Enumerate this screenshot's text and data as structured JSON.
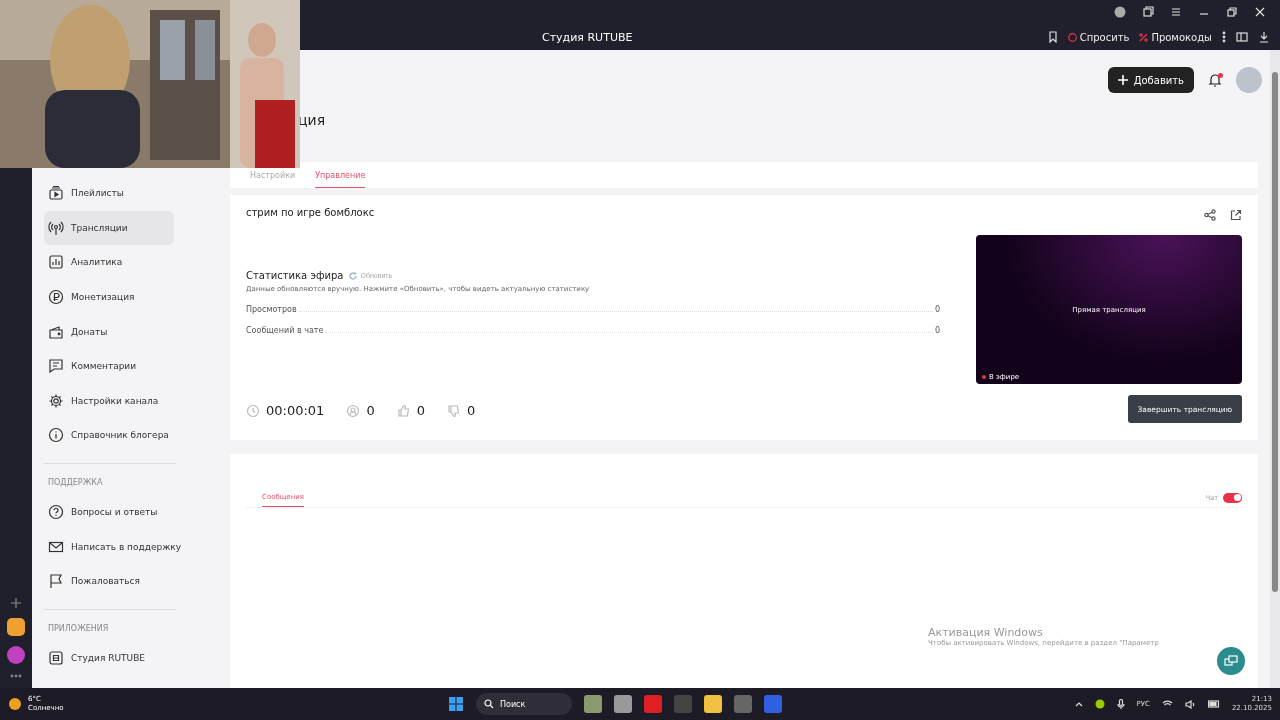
{
  "browser": {
    "tab_title": "Студия RUTUBE",
    "actions": [
      {
        "kind": "ask",
        "label": "Спросить"
      },
      {
        "kind": "promo",
        "label": "Промокоды"
      }
    ]
  },
  "header": {
    "add_button": "Добавить",
    "notification": true
  },
  "page_title": "ция",
  "sidebar": {
    "sections": [
      {
        "items": [
          {
            "label": "Плейлисты",
            "selected": false
          },
          {
            "label": "Трансляции",
            "selected": true
          },
          {
            "label": "Аналитика",
            "selected": false
          },
          {
            "label": "Монетизация",
            "selected": false
          },
          {
            "label": "Донаты",
            "selected": false
          },
          {
            "label": "Комментарии",
            "selected": false
          },
          {
            "label": "Настройки канала",
            "selected": false
          },
          {
            "label": "Справочник блогера",
            "selected": false
          }
        ]
      },
      {
        "heading": "ПОДДЕРЖКА",
        "items": [
          {
            "label": "Вопросы и ответы",
            "selected": false
          },
          {
            "label": "Написать в поддержку",
            "selected": false
          },
          {
            "label": "Пожаловаться",
            "selected": false
          }
        ]
      },
      {
        "heading": "ПРИЛОЖЕНИЯ",
        "items": [
          {
            "label": "Студия RUTUBE",
            "selected": false
          }
        ]
      }
    ]
  },
  "tabs": [
    {
      "label": "Настройки",
      "selected": false
    },
    {
      "label": "Управление",
      "selected": true
    }
  ],
  "stream": {
    "title": "стрим по игре бомблокс",
    "stats_title": "Статистика эфира",
    "refresh": "Обновить",
    "stats_note": "Данные обновляются вручную. Нажмите «Обновить», чтобы видеть актуальную статистику",
    "stats": [
      {
        "label": "Просмотров",
        "value": "0"
      },
      {
        "label": "Сообщений в чате",
        "value": "0"
      }
    ],
    "counters": [
      {
        "kind": "time",
        "value": "00:00:01"
      },
      {
        "kind": "viewers",
        "value": "0"
      },
      {
        "kind": "likes",
        "value": "0"
      },
      {
        "kind": "dislikes",
        "value": "0"
      }
    ],
    "preview": {
      "caption": "Прямая трансляция",
      "live_label": "В эфире"
    },
    "end_button": "Завершить трансляцию"
  },
  "chat": {
    "tabs": [
      {
        "label": "Сообщения",
        "selected": true
      }
    ],
    "toggle_label": "Чат",
    "chat_on": true
  },
  "activation": {
    "title": "Активация Windows",
    "text": "Чтобы активировать Windows, перейдите в раздел \"Параметр"
  },
  "taskbar": {
    "weather_temp": "6°C",
    "weather_text": "Солнечно",
    "search": "Поиск",
    "language": "РУС",
    "time": "21:13",
    "date": "22.10.2025"
  }
}
